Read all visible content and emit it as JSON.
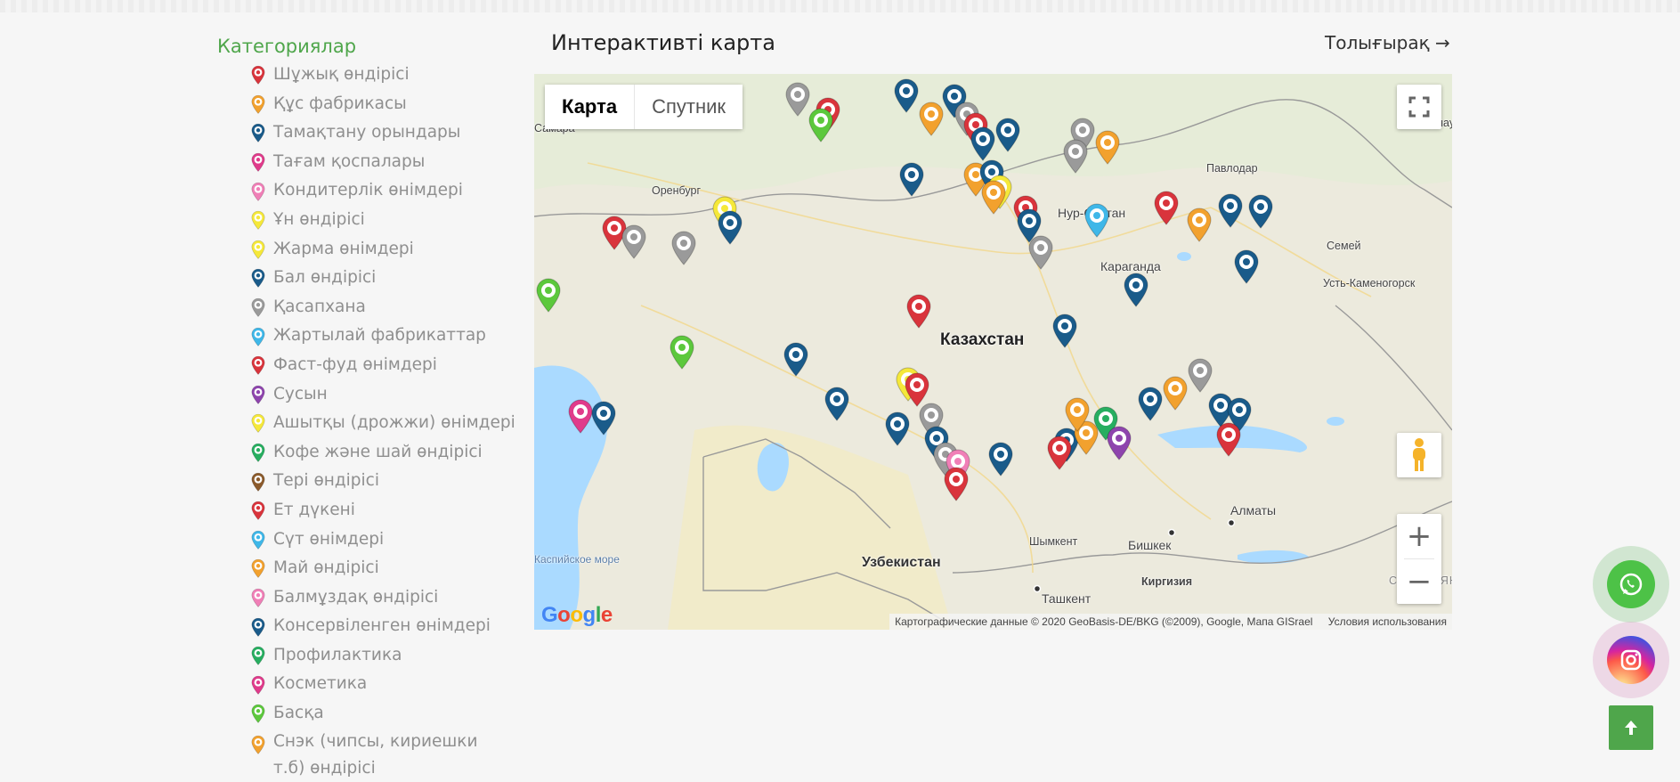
{
  "sidebar": {
    "title": "Категориялар",
    "categories": [
      {
        "label": "Шұжық өндірісі",
        "color": "#d9343c"
      },
      {
        "label": "Құс фабрикасы",
        "color": "#f2a12e"
      },
      {
        "label": "Тамақтану орындары",
        "color": "#1a5b8a"
      },
      {
        "label": "Тағам қоспалары",
        "color": "#e03b8b"
      },
      {
        "label": "Кондитерлік өнімдері",
        "color": "#f07fb7"
      },
      {
        "label": "Ұн өндірісі",
        "color": "#f5e83a"
      },
      {
        "label": "Жарма өнімдері",
        "color": "#f5e83a"
      },
      {
        "label": "Бал өндірісі",
        "color": "#1a5b8a"
      },
      {
        "label": "Қасапхана",
        "color": "#9a9a9a"
      },
      {
        "label": "Жартылай фабрикаттар",
        "color": "#3fb7e8"
      },
      {
        "label": "Фаст-фуд өнімдері",
        "color": "#d9343c"
      },
      {
        "label": "Сусын",
        "color": "#8e44ad"
      },
      {
        "label": "Ашытқы (дрожжи) өнімдері",
        "color": "#f5e83a"
      },
      {
        "label": "Кофе және шай өндірісі",
        "color": "#27ae60"
      },
      {
        "label": "Тері өндірісі",
        "color": "#8b5a2b"
      },
      {
        "label": "Ет дүкені",
        "color": "#d9343c"
      },
      {
        "label": "Сүт өнімдері",
        "color": "#3fb7e8"
      },
      {
        "label": "Май өндірісі",
        "color": "#f2a12e"
      },
      {
        "label": "Балмұздақ өндірісі",
        "color": "#f07fb7"
      },
      {
        "label": "Консервіленген өнімдері",
        "color": "#1a5b8a"
      },
      {
        "label": "Профилактика",
        "color": "#27ae60"
      },
      {
        "label": "Косметика",
        "color": "#e03b8b"
      },
      {
        "label": "Басқа",
        "color": "#5cc83c"
      },
      {
        "label": "Снэк (чипсы, кириешки т.б) өндірісі",
        "color": "#f2a12e"
      }
    ]
  },
  "header": {
    "title": "Интерактивті карта",
    "more_link": "Толығырақ →"
  },
  "map": {
    "type_buttons": {
      "map": "Карта",
      "satellite": "Спутник"
    },
    "zoom_in": "+",
    "zoom_out": "−",
    "google_letters": [
      "G",
      "o",
      "o",
      "g",
      "l",
      "e"
    ],
    "attribution": "Картографические данные © 2020 GeoBasis-DE/BKG (©2009), Google, Мапа GISrael",
    "terms": "Условия использования",
    "labels": {
      "kazakhstan": "Казахстан",
      "uzbekistan": "Узбекистан",
      "kyrgyzstan": "Киргизия",
      "samara": "Самара",
      "orenburg": "Оренбург",
      "pavlodar": "Павлодар",
      "astana": "Нур-Султан",
      "karaganda": "Караганда",
      "semey": "Семей",
      "ust_kamenogorsk": "Усть-Каменогорск",
      "barnaul": "Барнаул",
      "bishkek": "Бишкек",
      "tashkent": "Ташкент",
      "shymkent": "Шымкент",
      "almaty": "Алматы",
      "caspian": "Каспийское море",
      "xinjiang": "СИНЬЦЗЯН"
    },
    "markers": [
      {
        "color": "#9a9a9a"
      },
      {
        "color": "#d9343c"
      },
      {
        "color": "#5cc83c"
      },
      {
        "color": "#1a5b8a"
      },
      {
        "color": "#f2a12e"
      },
      {
        "color": "#1a5b8a"
      },
      {
        "color": "#9a9a9a"
      },
      {
        "color": "#d9343c"
      },
      {
        "color": "#1a5b8a"
      },
      {
        "color": "#1a5b8a"
      },
      {
        "color": "#9a9a9a"
      },
      {
        "color": "#9a9a9a"
      },
      {
        "color": "#f2a12e"
      },
      {
        "color": "#1a5b8a"
      },
      {
        "color": "#f2a12e"
      },
      {
        "color": "#1a5b8a"
      },
      {
        "color": "#f5e83a"
      },
      {
        "color": "#f2a12e"
      },
      {
        "color": "#d9343c"
      },
      {
        "color": "#1a5b8a"
      },
      {
        "color": "#3fb7e8"
      },
      {
        "color": "#9a9a9a"
      },
      {
        "color": "#d9343c"
      },
      {
        "color": "#f2a12e"
      },
      {
        "color": "#1a5b8a"
      },
      {
        "color": "#1a5b8a"
      },
      {
        "color": "#1a5b8a"
      },
      {
        "color": "#f5e83a"
      },
      {
        "color": "#1a5b8a"
      },
      {
        "color": "#d9343c"
      },
      {
        "color": "#9a9a9a"
      },
      {
        "color": "#9a9a9a"
      },
      {
        "color": "#d9343c"
      },
      {
        "color": "#1a5b8a"
      },
      {
        "color": "#1a5b8a"
      },
      {
        "color": "#5cc83c"
      },
      {
        "color": "#5cc83c"
      },
      {
        "color": "#1a5b8a"
      },
      {
        "color": "#e03b8b"
      },
      {
        "color": "#1a5b8a"
      },
      {
        "color": "#1a5b8a"
      },
      {
        "color": "#f5e83a"
      },
      {
        "color": "#d9343c"
      },
      {
        "color": "#1a5b8a"
      },
      {
        "color": "#9a9a9a"
      },
      {
        "color": "#1a5b8a"
      },
      {
        "color": "#9a9a9a"
      },
      {
        "color": "#f07fb7"
      },
      {
        "color": "#d9343c"
      },
      {
        "color": "#1a5b8a"
      },
      {
        "color": "#1a5b8a"
      },
      {
        "color": "#f2a12e"
      },
      {
        "color": "#d9343c"
      },
      {
        "color": "#f2a12e"
      },
      {
        "color": "#27ae60"
      },
      {
        "color": "#8e44ad"
      },
      {
        "color": "#1a5b8a"
      },
      {
        "color": "#f2a12e"
      },
      {
        "color": "#9a9a9a"
      },
      {
        "color": "#1a5b8a"
      },
      {
        "color": "#1a5b8a"
      },
      {
        "color": "#d9343c"
      }
    ]
  },
  "floating": {
    "whatsapp": "whatsapp-icon",
    "instagram": "instagram-icon",
    "scroll_top": "arrow-up-icon"
  },
  "colors": {
    "accent_green": "#4fa64b",
    "water": "#aadaff",
    "land": "#eceadd"
  }
}
